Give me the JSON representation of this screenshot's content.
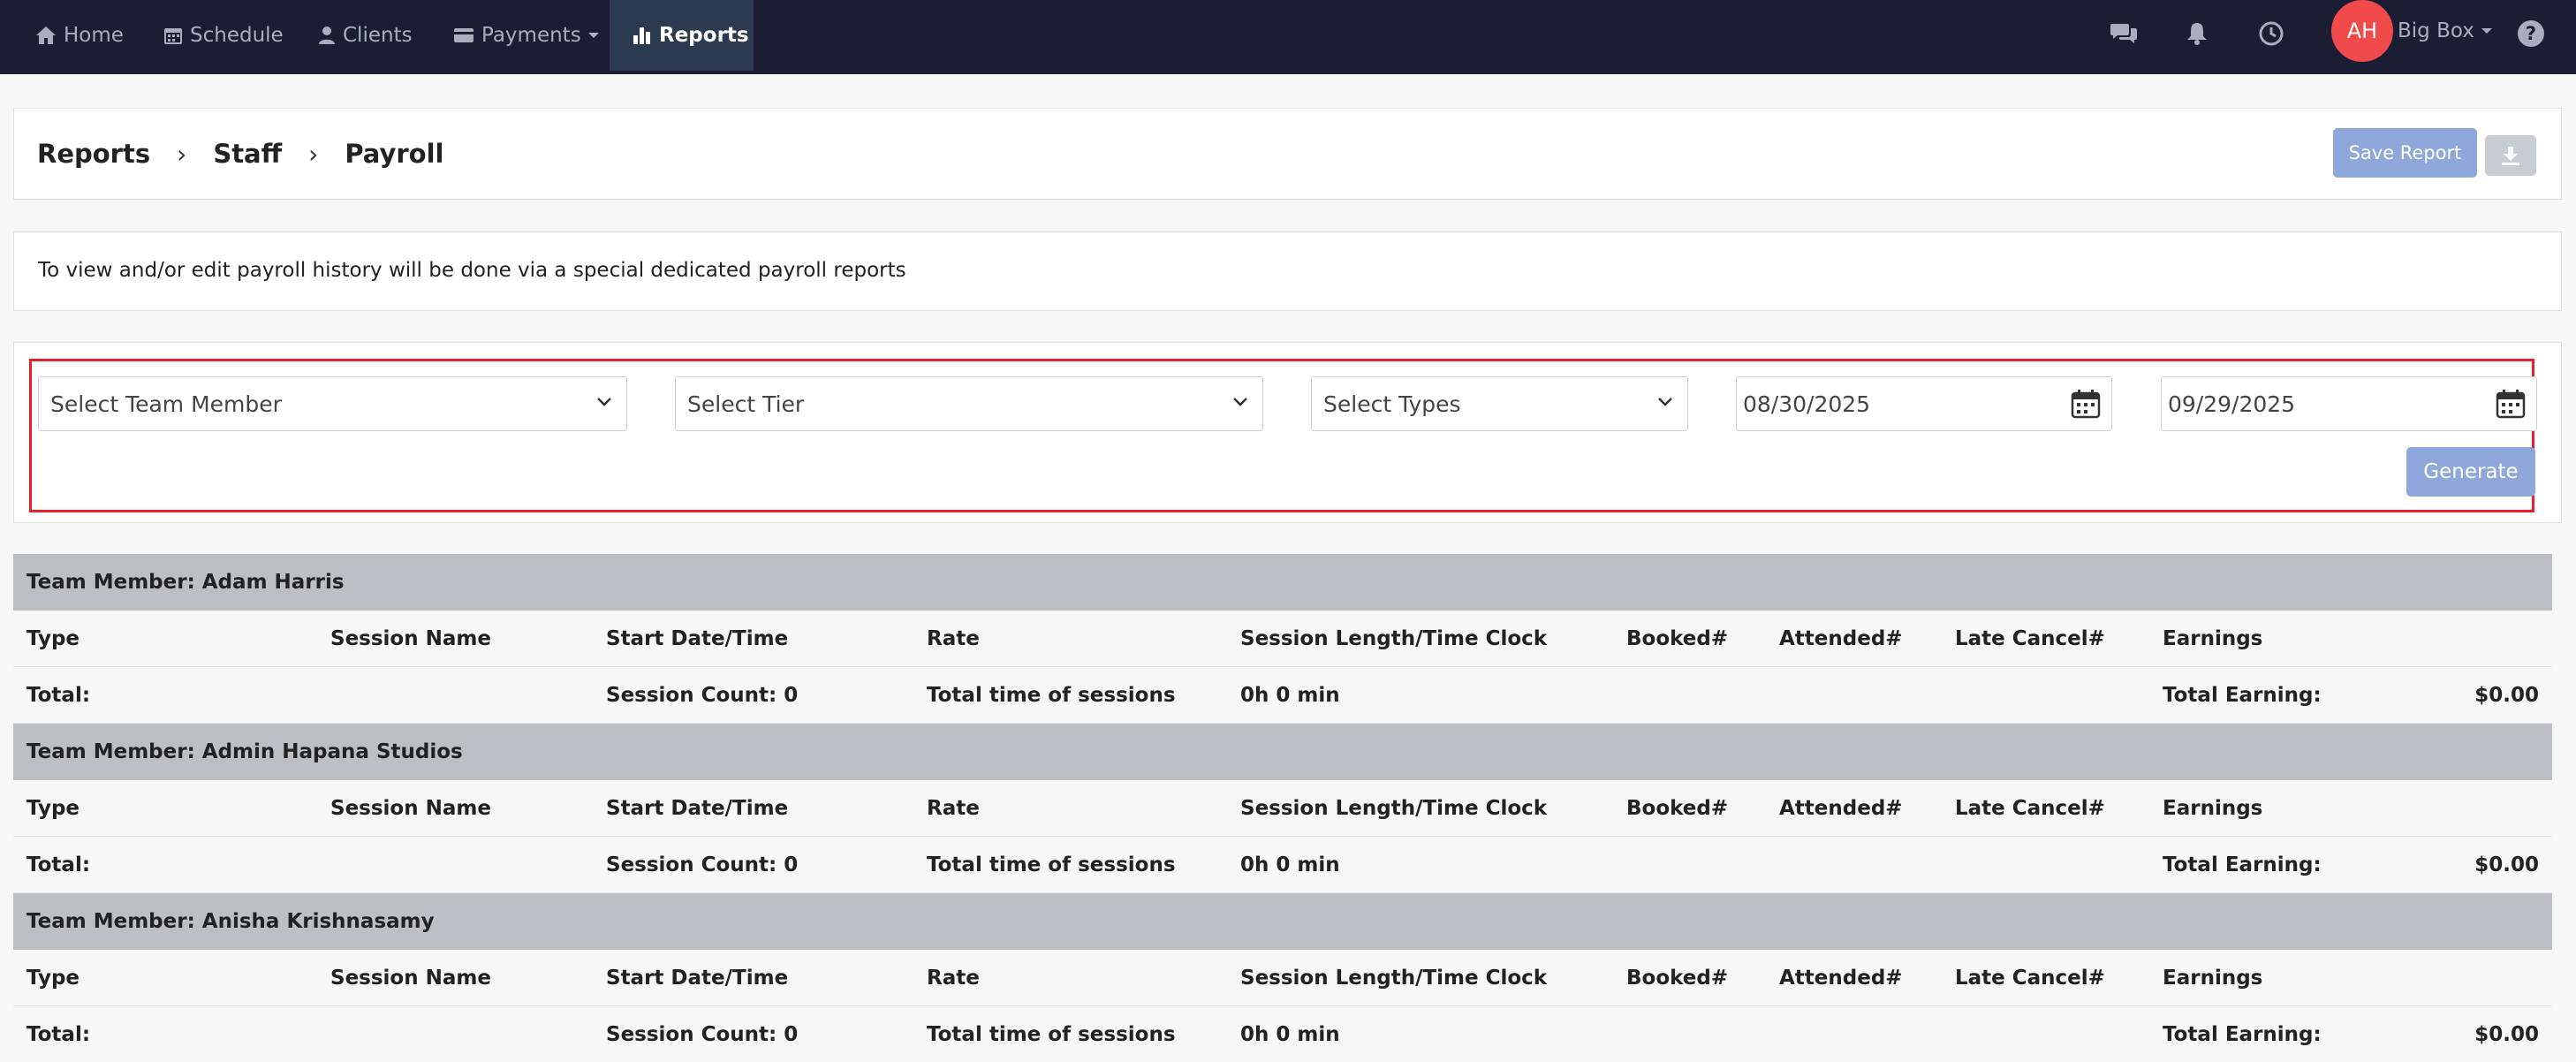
{
  "nav": {
    "items": [
      {
        "label": "Home",
        "icon": "home-icon"
      },
      {
        "label": "Schedule",
        "icon": "calendar-icon"
      },
      {
        "label": "Clients",
        "icon": "user-icon"
      },
      {
        "label": "Payments",
        "icon": "card-icon"
      },
      {
        "label": "Reports",
        "icon": "bar-chart-icon",
        "active": true
      }
    ],
    "avatar_initials": "AH",
    "account_name": "Big Box"
  },
  "header": {
    "breadcrumb": [
      "Reports",
      "Staff",
      "Payroll"
    ],
    "separator": "›",
    "save_label": "Save Report"
  },
  "notice": "To view and/or edit payroll history will be done via a special dedicated payroll reports",
  "filters": {
    "team_member_placeholder": "Select Team Member",
    "tier_placeholder": "Select Tier",
    "types_placeholder": "Select Types",
    "start_date": "08/30/2025",
    "end_date": "09/29/2025",
    "generate_label": "Generate"
  },
  "table": {
    "member_prefix": "Team Member: ",
    "columns": [
      "Type",
      "Session Name",
      "Start Date/Time",
      "Rate",
      "Session Length/Time Clock",
      "Booked#",
      "Attended#",
      "Late Cancel#",
      "Earnings"
    ],
    "total_labels": {
      "total": "Total:",
      "total_time": "Total time of sessions",
      "total_earning": "Total Earning:"
    },
    "members": [
      {
        "name": "Adam Harris",
        "session_count": "Session Count: 0",
        "time": "0h 0 min",
        "earnings": "$0.00"
      },
      {
        "name": "Admin Hapana Studios",
        "session_count": "Session Count: 0",
        "time": "0h 0 min",
        "earnings": "$0.00"
      },
      {
        "name": "Anisha Krishnasamy",
        "session_count": "Session Count: 0",
        "time": "0h 0 min",
        "earnings": "$0.00"
      }
    ]
  },
  "colors": {
    "nav_bg": "#1b1e33",
    "accent_button": "#8fa8db",
    "avatar": "#f04a4a",
    "highlight_frame": "#e8202a",
    "member_row": "#bdbfc3"
  }
}
